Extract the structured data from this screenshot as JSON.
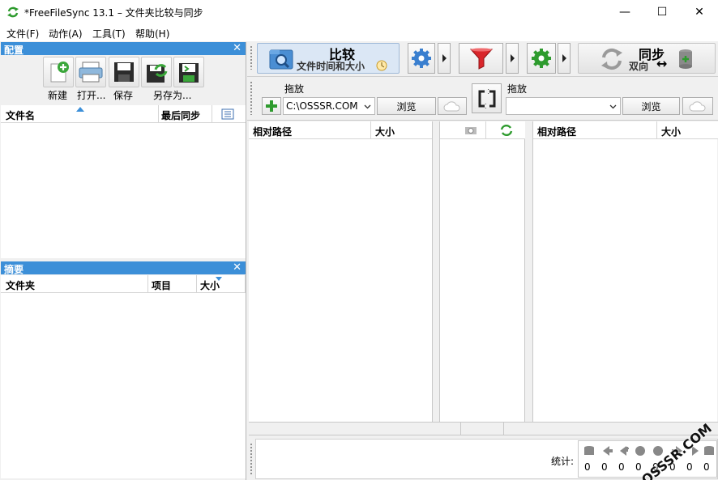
{
  "window": {
    "title": "*FreeFileSync 13.1 – 文件夹比较与同步",
    "controls": {
      "minimize": "—",
      "maximize": "☐",
      "close": "✕"
    }
  },
  "menu": [
    "文件(F)",
    "动作(A)",
    "工具(T)",
    "帮助(H)"
  ],
  "config_panel": {
    "title": "配置",
    "buttons": {
      "new": "新建",
      "open": "打开...",
      "save": "保存",
      "save_as": "另存为..."
    },
    "columns": {
      "filename": "文件名",
      "last_sync": "最后同步"
    }
  },
  "summary_panel": {
    "title": "摘要",
    "columns": {
      "folder": "文件夹",
      "items": "项目",
      "size": "大小"
    }
  },
  "toolbar": {
    "compare_label": "比较",
    "compare_sub": "文件时间和大小",
    "sync_label": "同步",
    "sync_sub": "双向"
  },
  "folders": {
    "left_drop_label": "拖放",
    "right_drop_label": "拖放",
    "left_path": "C:\\OSSSR.COM",
    "right_path": "",
    "browse_label": "浏览"
  },
  "grid": {
    "left_cols": {
      "rel_path": "相对路径",
      "size": "大小"
    },
    "right_cols": {
      "rel_path": "相对路径",
      "size": "大小"
    }
  },
  "stats": {
    "label": "统计:",
    "values": [
      "0",
      "0",
      "0",
      "0",
      "0",
      "0",
      "0",
      "0"
    ]
  },
  "watermark": "OSSSR.COM",
  "colors": {
    "panel_header": "#3c8fd8",
    "accent_green": "#2e9b2e",
    "filter_red": "#d9262b"
  }
}
